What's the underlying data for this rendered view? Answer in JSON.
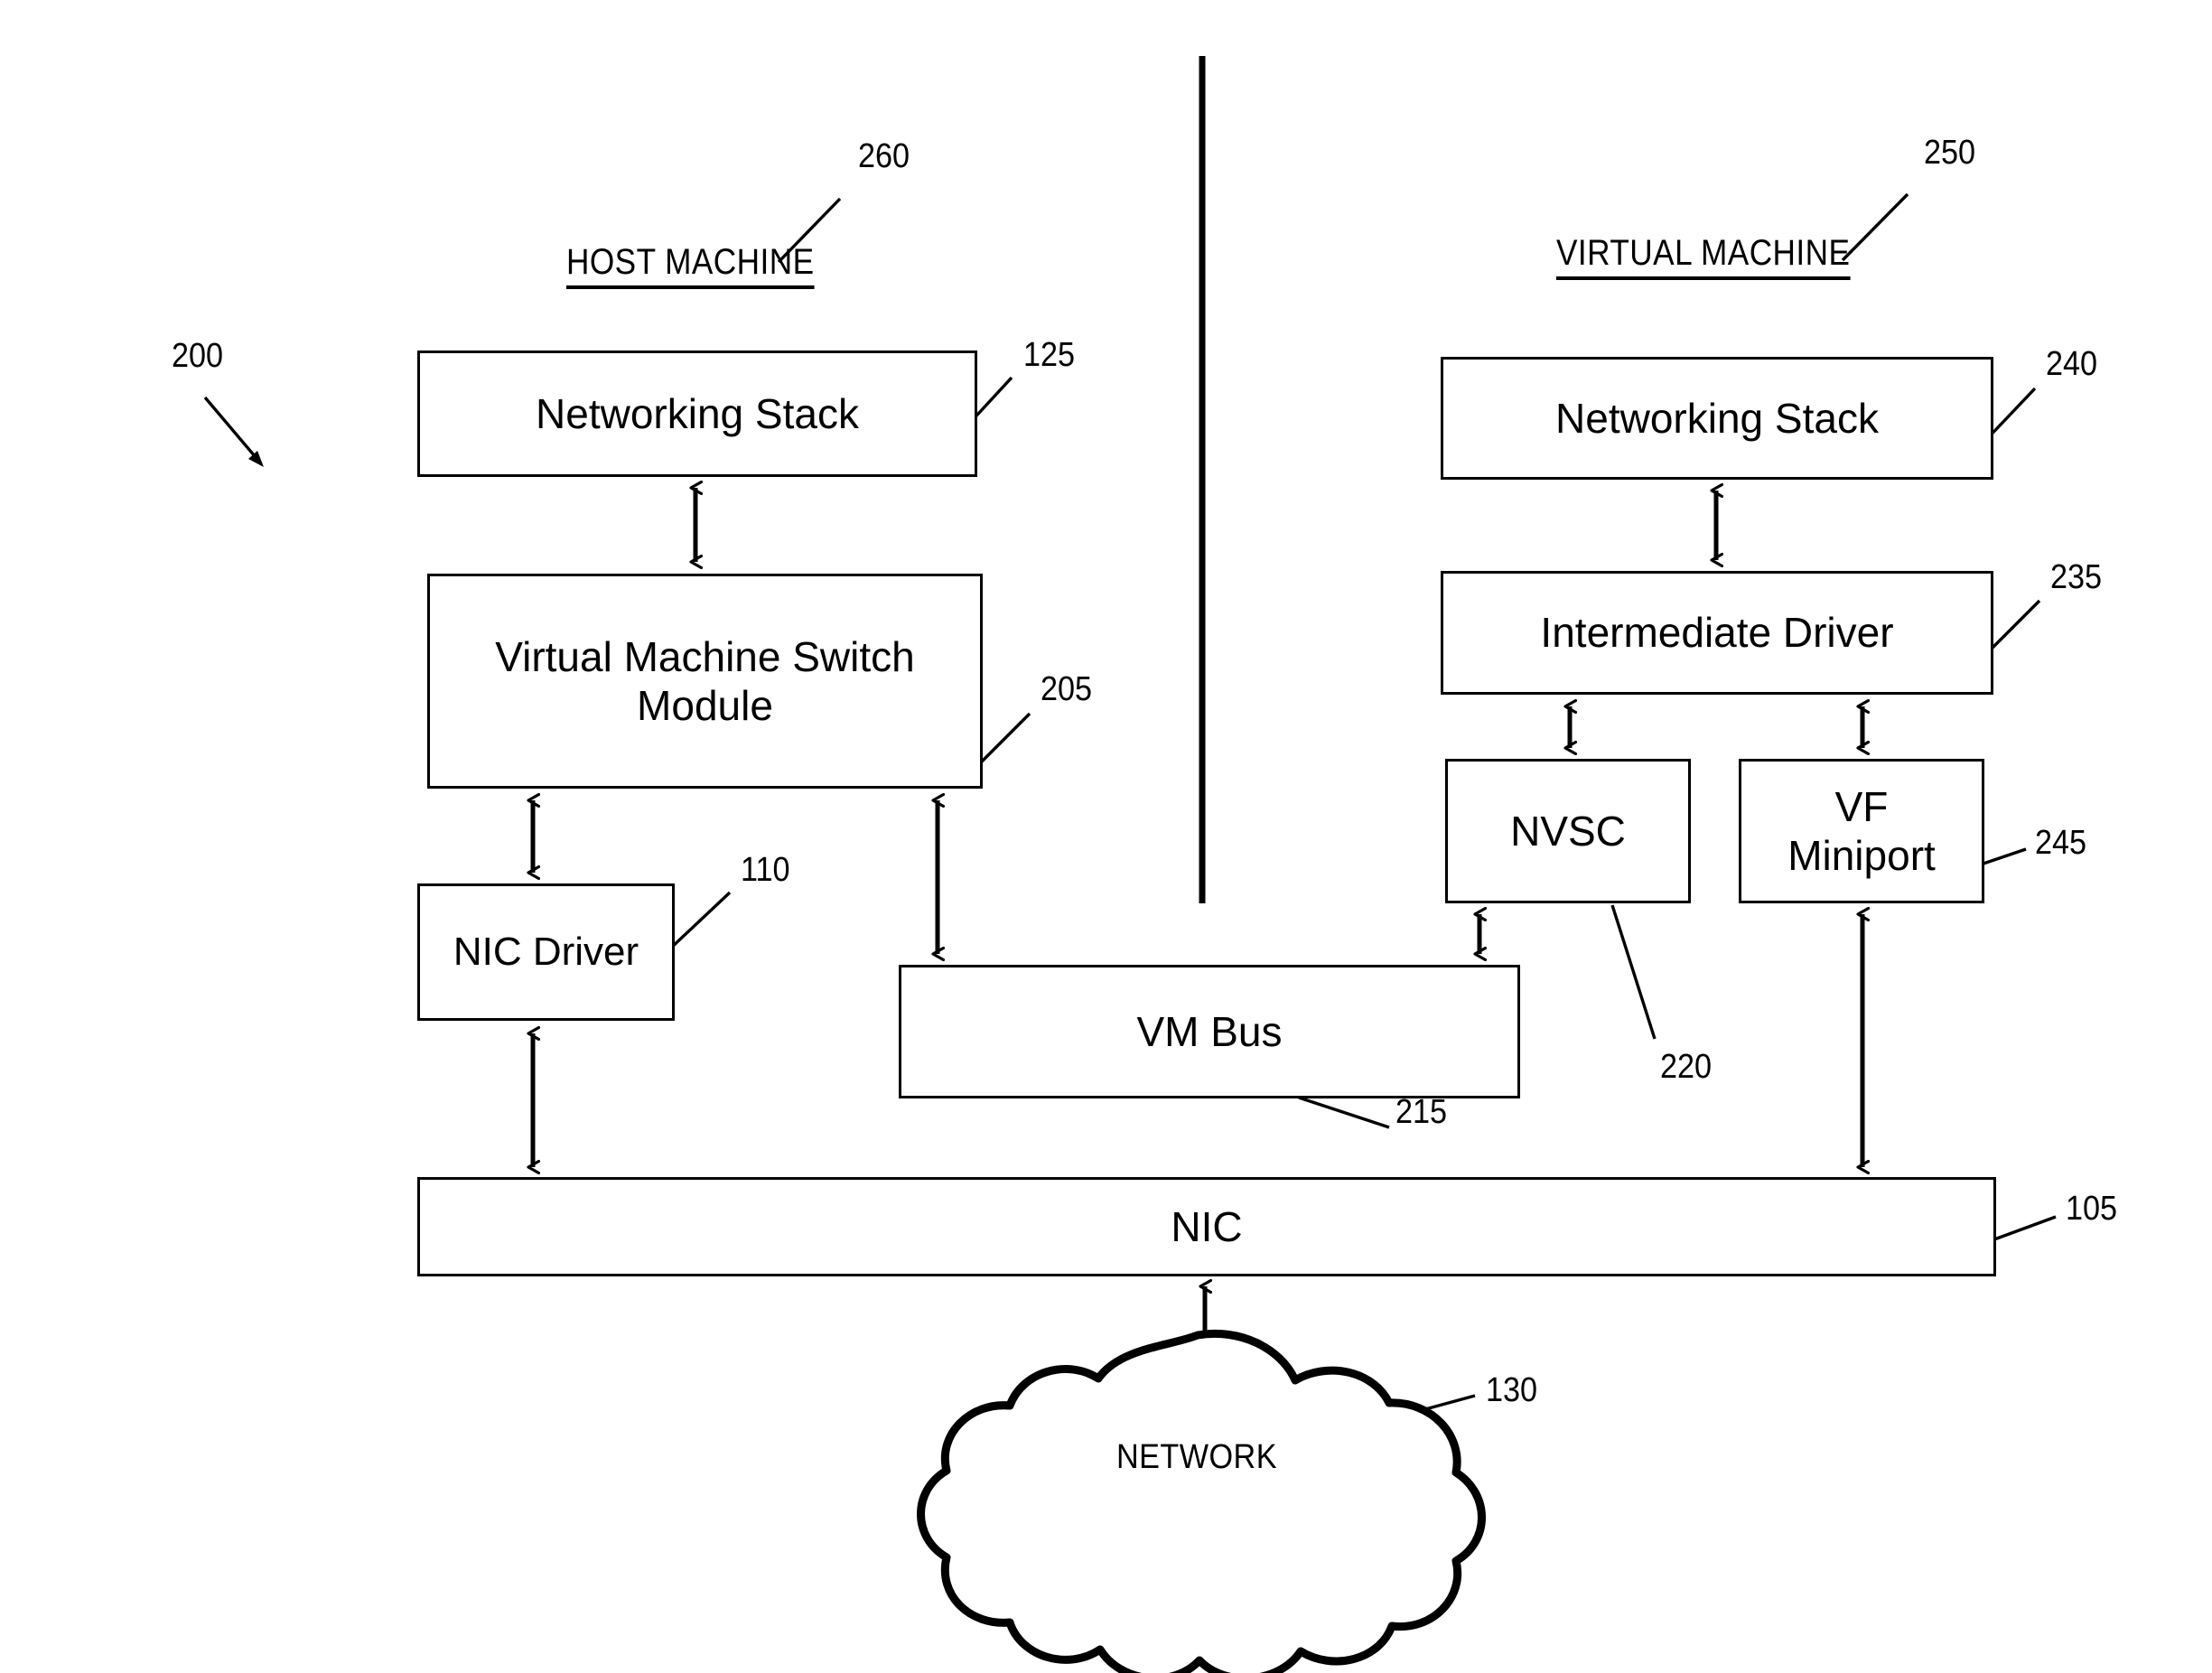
{
  "figure": {
    "ref_main": "200",
    "sections": [
      {
        "id": "host",
        "title": "HOST MACHINE",
        "ref": "260"
      },
      {
        "id": "vm",
        "title": "VIRTUAL MACHINE",
        "ref": "250"
      }
    ],
    "boxes": {
      "netstack_host": {
        "label": "Networking Stack",
        "ref": "125"
      },
      "vm_switch_module": {
        "label": "Virtual Machine Switch\nModule",
        "ref": "205"
      },
      "nic_driver": {
        "label": "NIC Driver",
        "ref": "110"
      },
      "vm_bus": {
        "label": "VM Bus",
        "ref": "215"
      },
      "netstack_vm": {
        "label": "Networking Stack",
        "ref": "240"
      },
      "intermediate_driver": {
        "label": "Intermediate Driver",
        "ref": "235"
      },
      "nvsc": {
        "label": "NVSC",
        "ref": "220"
      },
      "vf_miniport": {
        "label": "VF\nMiniport",
        "ref": "245"
      },
      "nic": {
        "label": "NIC",
        "ref": "105"
      },
      "network_cloud": {
        "label": "NETWORK",
        "ref": "130"
      }
    },
    "colors": {
      "stroke": "#000000",
      "fill": "#ffffff",
      "text": "#000000"
    }
  }
}
